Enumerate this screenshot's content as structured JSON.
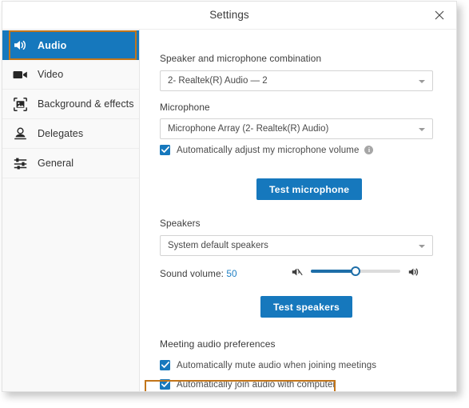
{
  "window": {
    "title": "Settings",
    "close_icon": "close-icon"
  },
  "sidebar": {
    "items": [
      {
        "label": "Audio",
        "icon": "speaker-icon",
        "active": true
      },
      {
        "label": "Video",
        "icon": "video-camera-icon",
        "active": false
      },
      {
        "label": "Background & effects",
        "icon": "image-frame-icon",
        "active": false
      },
      {
        "label": "Delegates",
        "icon": "person-icon",
        "active": false
      },
      {
        "label": "General",
        "icon": "sliders-icon",
        "active": false
      }
    ]
  },
  "content": {
    "combo_label": "Speaker and microphone combination",
    "combo_value": "2- Realtek(R) Audio — 2",
    "microphone_label": "Microphone",
    "microphone_value": "Microphone Array (2- Realtek(R) Audio)",
    "auto_adjust_label": "Automatically adjust my microphone volume",
    "auto_adjust_checked": true,
    "info_glyph": "i",
    "test_microphone_button": "Test microphone",
    "speakers_label": "Speakers",
    "speakers_value": "System default speakers",
    "sound_volume_label": "Sound volume:",
    "sound_volume_value": "50",
    "test_speakers_button": "Test speakers",
    "meeting_prefs_heading": "Meeting audio preferences",
    "auto_mute_label": "Automatically mute audio when joining meetings",
    "auto_mute_checked": true,
    "auto_join_label": "Automatically join audio with computer",
    "auto_join_checked": true
  },
  "colors": {
    "accent_blue": "#1678bd",
    "highlight_orange": "#c2751a",
    "slider_blue": "#1e6ea8",
    "sidebar_bg": "#f9f9f9"
  },
  "highlights": [
    {
      "target": "sidebar-item-audio",
      "color": "#c2751a"
    },
    {
      "target": "checkbox-auto-mute",
      "color": "#c2751a"
    }
  ]
}
